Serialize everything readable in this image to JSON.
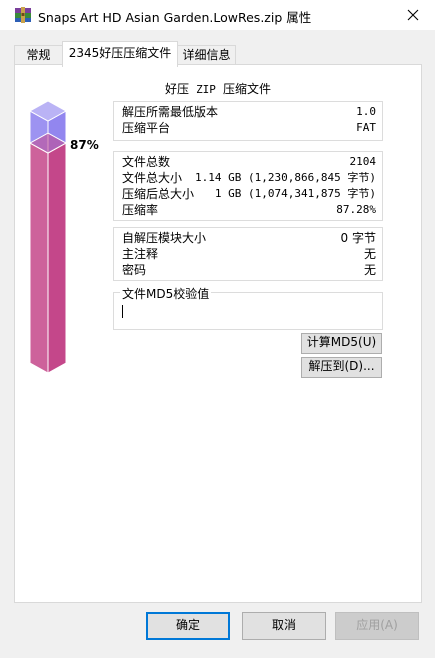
{
  "window": {
    "title": "Snaps Art HD Asian Garden.LowRes.zip 属性"
  },
  "tabs": [
    {
      "label": "常规"
    },
    {
      "label": "2345好压压缩文件"
    },
    {
      "label": "详细信息"
    }
  ],
  "archive": {
    "kind_prefix": "好压",
    "kind_format": "ZIP",
    "kind_suffix": "压缩文件"
  },
  "meter": {
    "ratio": 0.8728,
    "label": "87%"
  },
  "group1": [
    {
      "label": "解压所需最低版本",
      "value": "1.0"
    },
    {
      "label": "压缩平台",
      "value": "FAT"
    }
  ],
  "group2": [
    {
      "label": "文件总数",
      "value": "2104"
    },
    {
      "label": "文件总大小",
      "value": "1.14 GB (1,230,866,845 字节)"
    },
    {
      "label": "压缩后总大小",
      "value": "1 GB (1,074,341,875 字节)"
    },
    {
      "label": "压缩率",
      "value": "87.28%"
    }
  ],
  "group3": [
    {
      "label": "自解压模块大小",
      "value": "0 字节"
    },
    {
      "label": "主注释",
      "value": "无"
    },
    {
      "label": "密码",
      "value": "无"
    }
  ],
  "md5": {
    "label": "文件MD5校验值",
    "value": ""
  },
  "actions": {
    "calc_md5": "计算MD5(U)",
    "extract_to": "解压到(D)..."
  },
  "footer": {
    "ok": "确定",
    "cancel": "取消",
    "apply": "应用(A)"
  },
  "colors": {
    "meter_fill": "#c4478a",
    "meter_empty": "#8c80ee",
    "accent": "#0078d7"
  }
}
